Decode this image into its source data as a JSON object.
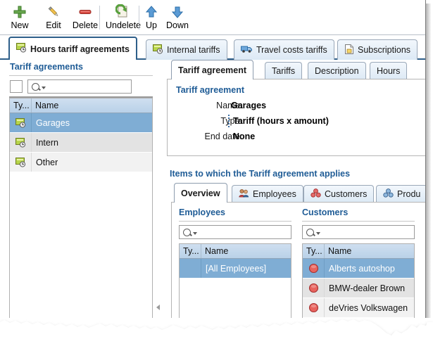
{
  "toolbar": {
    "items": [
      {
        "label": "New",
        "icon": "plus-icon"
      },
      {
        "label": "Edit",
        "icon": "pencil-icon"
      },
      {
        "label": "Delete",
        "icon": "minus-icon"
      },
      {
        "label": "Undelete",
        "icon": "undelete-icon"
      },
      {
        "label": "Up",
        "icon": "arrow-up-icon"
      },
      {
        "label": "Down",
        "icon": "arrow-down-icon"
      }
    ]
  },
  "main_tabs": [
    {
      "label": "Hours tariff agreements",
      "icon": "hours-tariff-icon",
      "active": true
    },
    {
      "label": "Internal tariffs",
      "icon": "hours-tariff-icon",
      "active": false
    },
    {
      "label": "Travel costs tariffs",
      "icon": "truck-icon",
      "active": false
    },
    {
      "label": "Subscriptions",
      "icon": "subscription-icon",
      "active": false
    }
  ],
  "left_panel": {
    "title": "Tariff agreements",
    "search": {
      "placeholder": "",
      "value": "",
      "icon": "search-icon"
    },
    "checkbox_checked": false,
    "grid": {
      "columns": [
        "Ty...",
        "Name"
      ],
      "rows": [
        {
          "icon": "hours-tariff-icon",
          "name": "Garages",
          "selected": true
        },
        {
          "icon": "hours-tariff-icon",
          "name": "Intern",
          "selected": false
        },
        {
          "icon": "hours-tariff-icon",
          "name": "Other",
          "selected": false
        }
      ]
    }
  },
  "detail_tabs": [
    {
      "label": "Tariff agreement",
      "active": true
    },
    {
      "label": "Tariffs",
      "active": false
    },
    {
      "label": "Description",
      "active": false
    },
    {
      "label": "Hours",
      "active": false
    }
  ],
  "detail": {
    "group_title": "Tariff agreement",
    "fields": [
      {
        "label": "Name:",
        "value": "Garages"
      },
      {
        "label": "Type:",
        "value": "Tariff (hours x amount)"
      },
      {
        "label": "End date:",
        "value": "None"
      }
    ]
  },
  "items_section": {
    "title": "Items to which the Tariff agreement applies",
    "tabs": [
      {
        "label": "Overview",
        "icon": "",
        "active": true
      },
      {
        "label": "Employees",
        "icon": "employees-icon",
        "active": false
      },
      {
        "label": "Customers",
        "icon": "customers-icon",
        "active": false
      },
      {
        "label": "Produ",
        "icon": "products-icon",
        "active": false
      }
    ],
    "employees": {
      "title": "Employees",
      "search": {
        "placeholder": "",
        "value": "",
        "icon": "search-icon"
      },
      "columns": [
        "Ty...",
        "Name"
      ],
      "rows": [
        {
          "icon": "",
          "name": "[All Employees]",
          "selected": true
        }
      ]
    },
    "customers": {
      "title": "Customers",
      "search": {
        "placeholder": "",
        "value": "",
        "icon": "search-icon"
      },
      "columns": [
        "Ty...",
        "Name"
      ],
      "rows": [
        {
          "icon": "customer-icon",
          "name": "Alberts autoshop",
          "selected": true
        },
        {
          "icon": "customer-icon",
          "name": "BMW-dealer Brown",
          "selected": false
        },
        {
          "icon": "customer-icon",
          "name": "deVries Volkswagen",
          "selected": false
        }
      ]
    }
  },
  "splitter": {
    "collapse_icon": "collapse-left-icon"
  },
  "colors": {
    "accent_blue": "#1f5c96",
    "active_tab_border": "#2e5f8a",
    "selection": "#7fadd4",
    "grid_header": "#b9d1e8",
    "customer_red": "#e04a4a"
  }
}
